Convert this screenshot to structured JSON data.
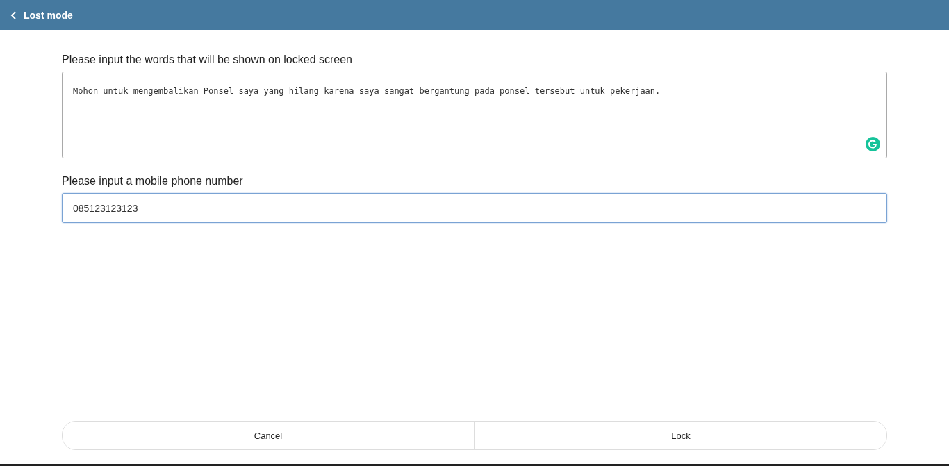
{
  "header": {
    "title": "Lost mode"
  },
  "message": {
    "label": "Please input the words that will be shown on locked screen",
    "value": "Mohon untuk mengembalikan Ponsel saya yang hilang karena saya sangat bergantung pada ponsel tersebut untuk pekerjaan."
  },
  "phone": {
    "label": "Please input a mobile phone number",
    "value": "085123123123",
    "focused": true
  },
  "buttons": [
    {
      "label": "Cancel"
    },
    {
      "label": "Lock"
    }
  ]
}
